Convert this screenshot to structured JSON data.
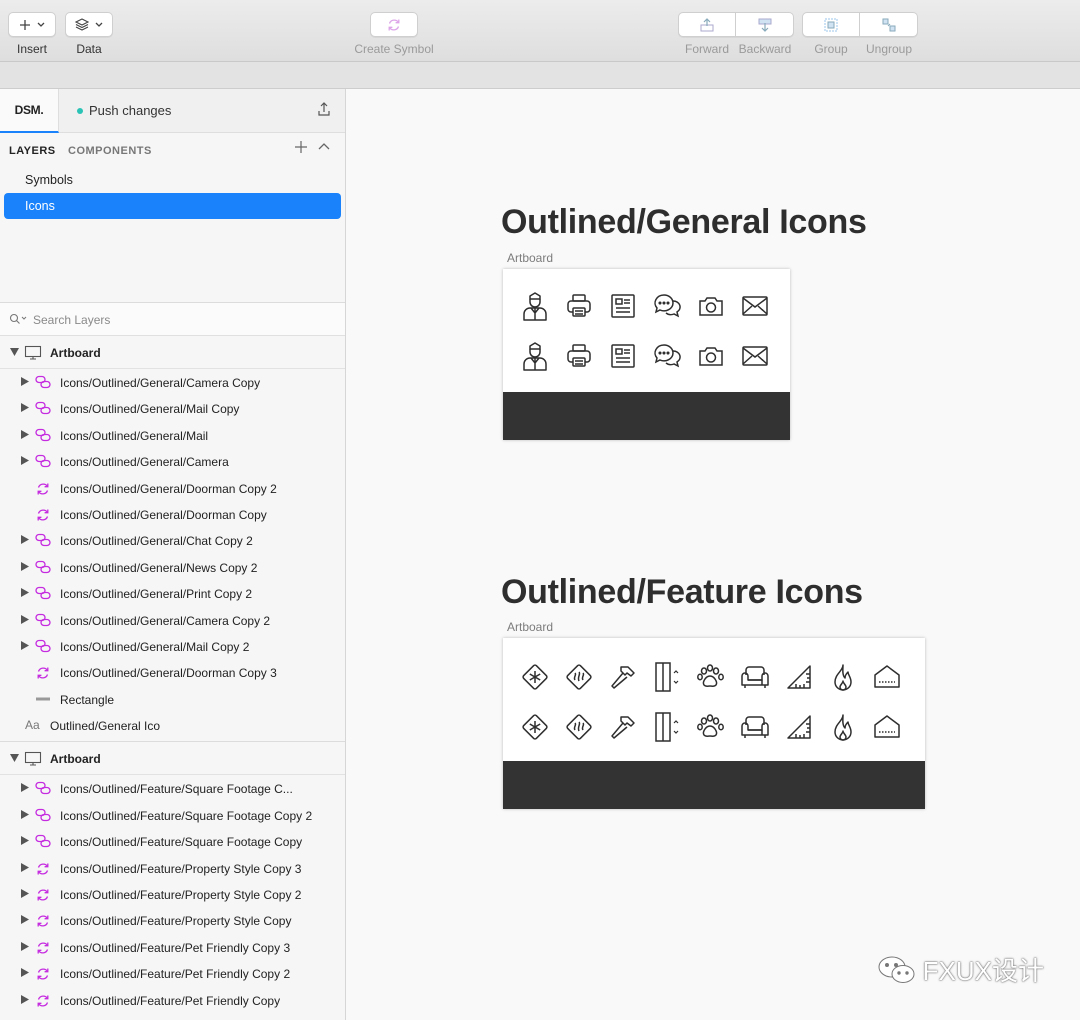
{
  "toolbar": {
    "insert_label": "Insert",
    "data_label": "Data",
    "create_symbol_label": "Create Symbol",
    "forward_label": "Forward",
    "backward_label": "Backward",
    "group_label": "Group",
    "ungroup_label": "Ungroup"
  },
  "sidebar": {
    "dsm_label": "DSM.",
    "push_label": "Push changes",
    "tabs": {
      "layers": "LAYERS",
      "components": "COMPONENTS"
    },
    "pages": [
      {
        "label": "Symbols"
      },
      {
        "label": "Icons"
      }
    ],
    "search_placeholder": "Search Layers",
    "groups": [
      {
        "label": "Artboard",
        "layers": [
          {
            "label": "Icons/Outlined/General/Camera Copy",
            "kind": "symbol-instance"
          },
          {
            "label": "Icons/Outlined/General/Mail Copy",
            "kind": "symbol-instance"
          },
          {
            "label": "Icons/Outlined/General/Mail",
            "kind": "symbol-instance"
          },
          {
            "label": "Icons/Outlined/General/Camera",
            "kind": "symbol-instance"
          },
          {
            "label": "Icons/Outlined/General/Doorman Copy 2",
            "kind": "symbol-master"
          },
          {
            "label": "Icons/Outlined/General/Doorman Copy",
            "kind": "symbol-master"
          },
          {
            "label": "Icons/Outlined/General/Chat Copy 2",
            "kind": "symbol-instance"
          },
          {
            "label": "Icons/Outlined/General/News Copy 2",
            "kind": "symbol-instance"
          },
          {
            "label": "Icons/Outlined/General/Print Copy 2",
            "kind": "symbol-instance"
          },
          {
            "label": "Icons/Outlined/General/Camera Copy 2",
            "kind": "symbol-instance"
          },
          {
            "label": "Icons/Outlined/General/Mail Copy 2",
            "kind": "symbol-instance"
          },
          {
            "label": "Icons/Outlined/General/Doorman Copy 3",
            "kind": "symbol-master"
          },
          {
            "label": "Rectangle",
            "kind": "rectangle"
          },
          {
            "label": "Outlined/General Ico",
            "kind": "text",
            "text_icon": "Aa"
          }
        ]
      },
      {
        "label": "Artboard",
        "layers": [
          {
            "label": "Icons/Outlined/Feature/Square Footage C...",
            "kind": "symbol-instance"
          },
          {
            "label": "Icons/Outlined/Feature/Square Footage Copy 2",
            "kind": "symbol-instance"
          },
          {
            "label": "Icons/Outlined/Feature/Square Footage Copy",
            "kind": "symbol-instance"
          },
          {
            "label": "Icons/Outlined/Feature/Property Style Copy 3",
            "kind": "symbol-master-expand"
          },
          {
            "label": "Icons/Outlined/Feature/Property Style Copy 2",
            "kind": "symbol-master-expand"
          },
          {
            "label": "Icons/Outlined/Feature/Property Style Copy",
            "kind": "symbol-master-expand"
          },
          {
            "label": "Icons/Outlined/Feature/Pet Friendly Copy 3",
            "kind": "symbol-master-expand"
          },
          {
            "label": "Icons/Outlined/Feature/Pet Friendly Copy 2",
            "kind": "symbol-master-expand"
          },
          {
            "label": "Icons/Outlined/Feature/Pet Friendly Copy",
            "kind": "symbol-master-expand"
          }
        ]
      }
    ]
  },
  "canvas": {
    "boards": [
      {
        "title": "Outlined/General Icons",
        "label": "Artboard",
        "icons": [
          "doorman-icon",
          "print-icon",
          "news-icon",
          "chat-icon",
          "camera-icon",
          "mail-icon"
        ]
      },
      {
        "title": "Outlined/Feature Icons",
        "label": "Artboard",
        "icons": [
          "air-conditioning-icon",
          "heating-icon",
          "hammer-icon",
          "elevator-icon",
          "pet-friendly-icon",
          "armchair-icon",
          "square-footage-icon",
          "fire-icon",
          "property-style-icon"
        ]
      }
    ]
  },
  "watermark": "FXUX设计",
  "colors": {
    "accent": "#1a82fb",
    "symbol_purple": "#c52ce0",
    "push_dot": "#2bc3b6",
    "dark_bar": "#333333"
  }
}
